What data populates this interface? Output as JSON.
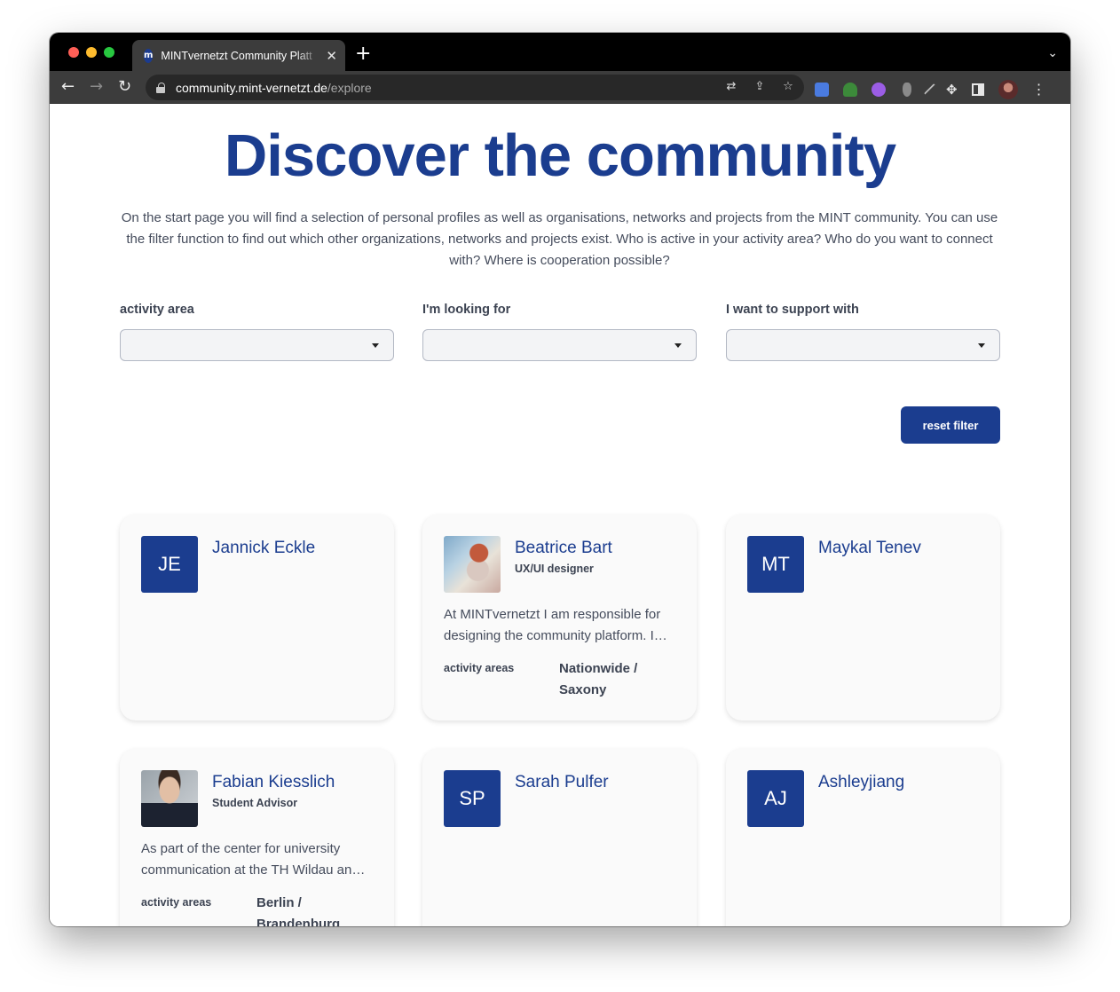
{
  "browser": {
    "tab_title": "MINTvernetzt Community Platt",
    "tab_favicon_letter": "m",
    "url_host": "community.mint-vernetzt.de",
    "url_path": "/explore"
  },
  "page": {
    "title": "Discover the community",
    "intro": "On the start page you will find a selection of personal profiles as well as organisations, networks and projects from the MINT community. You can use the filter function to find out which other organizations, networks and projects exist. Who is active in your activity area? Who do you want to connect with? Where is cooperation possible?"
  },
  "filters": {
    "activity_area_label": "activity area",
    "looking_for_label": "I'm looking for",
    "support_with_label": "I want to support with",
    "reset_label": "reset filter"
  },
  "cards": [
    {
      "name": "Jannick Eckle",
      "initials": "JE"
    },
    {
      "name": "Beatrice Bart",
      "position": "UX/UI designer",
      "bio": "At MINTvernetzt I am responsible for designing the community platform. I…",
      "areas_label": "activity areas",
      "areas": "Nationwide / Saxony"
    },
    {
      "name": "Maykal Tenev",
      "initials": "MT"
    },
    {
      "name": "Fabian Kiesslich",
      "position": "Student Advisor",
      "bio": "As part of the center for university communication at the TH Wildau an…",
      "areas_label": "activity areas",
      "areas": "Berlin / Brandenburg"
    },
    {
      "name": "Sarah Pulfer",
      "initials": "SP"
    },
    {
      "name": "Ashleyjiang",
      "initials": "AJ"
    }
  ],
  "colors": {
    "brand": "#1b3d8f",
    "card_bg": "#fafafa"
  }
}
